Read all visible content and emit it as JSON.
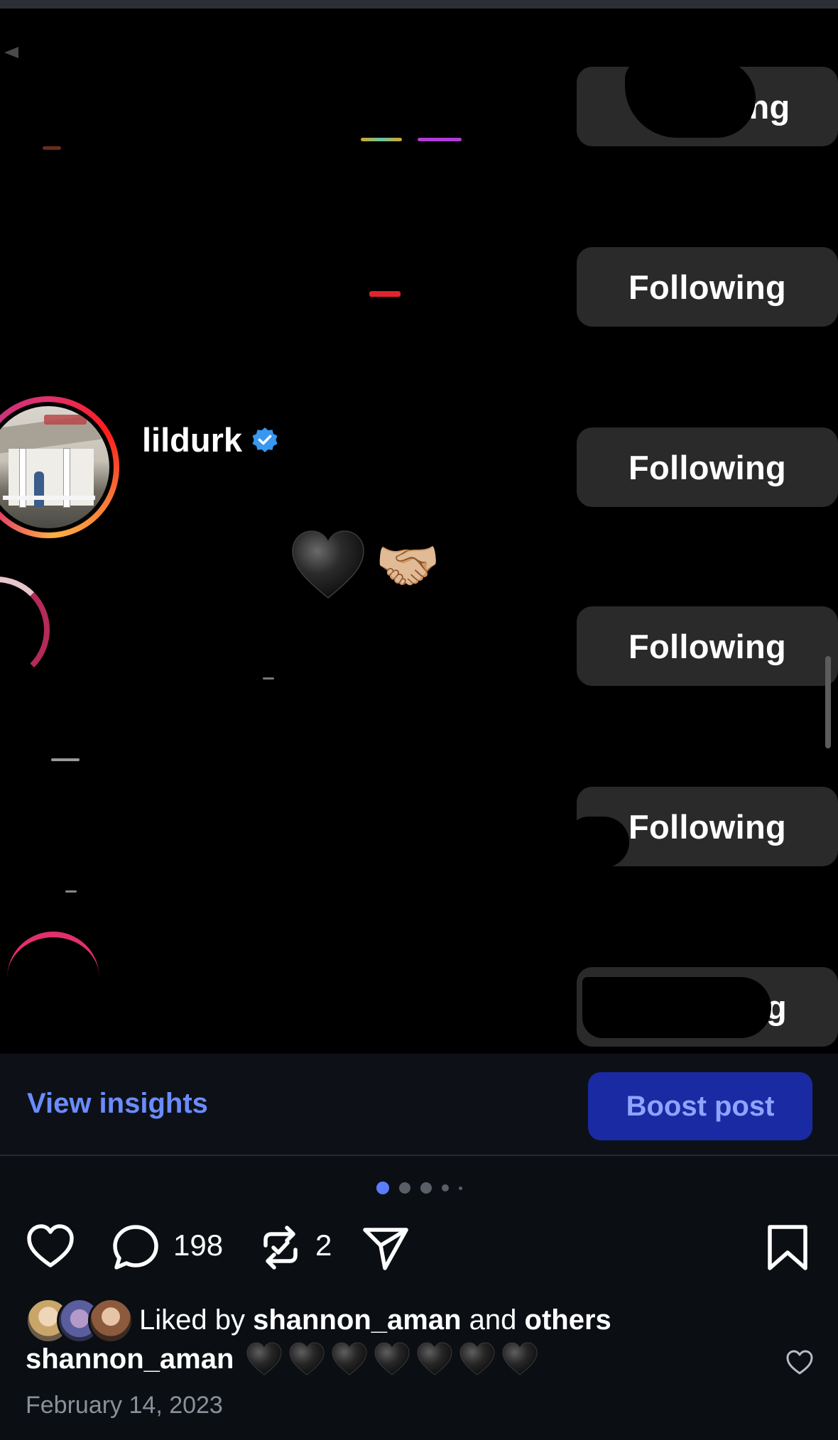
{
  "following_list": {
    "button_label": "Following",
    "partial_top_label": "ollowing",
    "partial_bottom_label": "g",
    "highlighted_user": {
      "username": "lildurk",
      "verified": true,
      "bio_emojis": [
        "🖤",
        "🤝🏼"
      ]
    }
  },
  "insights_bar": {
    "view_insights_label": "View insights",
    "boost_label": "Boost post"
  },
  "carousel": {
    "total_slides": 5,
    "active_index": 0
  },
  "actions": {
    "like_icon": "heart-outline-icon",
    "comment_icon": "comment-bubble-icon",
    "comment_count": "198",
    "repost_icon": "repost-icon",
    "repost_count": "2",
    "share_icon": "paper-plane-icon",
    "save_icon": "bookmark-icon"
  },
  "likes": {
    "prefix": "Liked by",
    "user": "shannon_aman",
    "joiner": "and",
    "others": "others"
  },
  "caption": {
    "username": "shannon_aman",
    "heart_count": 7
  },
  "date": "February 14, 2023",
  "colors": {
    "link_blue": "#6b8cff",
    "boost_bg": "#1a2aa3",
    "background": "#0b0f14"
  }
}
